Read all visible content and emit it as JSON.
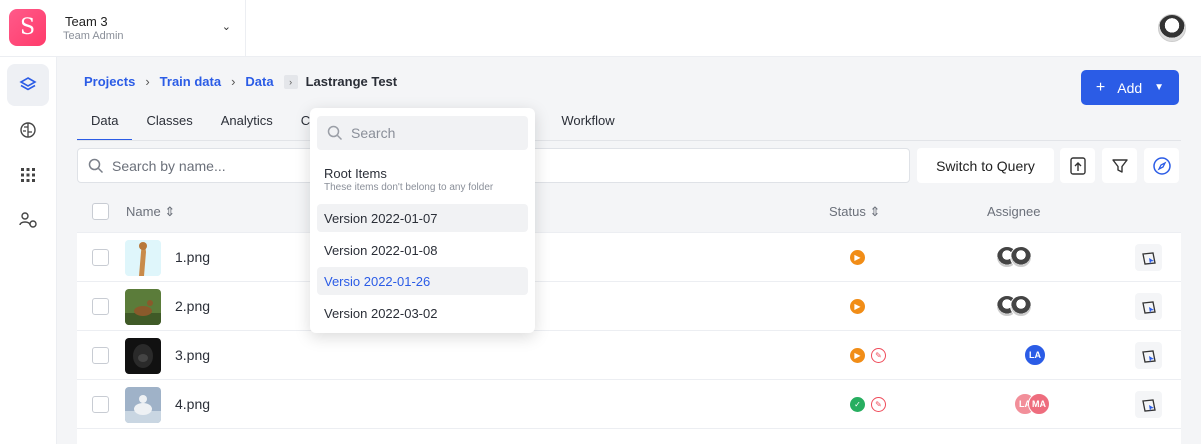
{
  "app": {
    "logo_letter": "S",
    "team_name": "Team 3",
    "team_role": "Team Admin"
  },
  "breadcrumb": {
    "items": [
      "Projects",
      "Train data",
      "Data"
    ],
    "current": "Lastrange Test"
  },
  "add_button": {
    "label": "Add"
  },
  "tabs": [
    {
      "label": "Data"
    },
    {
      "label": "Classes"
    },
    {
      "label": "Analytics"
    },
    {
      "label": "C"
    },
    {
      "label": "d"
    },
    {
      "label": "Workflow"
    }
  ],
  "search": {
    "placeholder": "Search by name..."
  },
  "switch_query": {
    "label": "Switch to Query"
  },
  "table": {
    "headers": {
      "name": "Name",
      "status": "Status",
      "assignee": "Assignee"
    },
    "rows": [
      {
        "name": "1.png",
        "status": [
          "in-progress"
        ],
        "assignee": [
          "avatar-img",
          "avatar-img"
        ]
      },
      {
        "name": "2.png",
        "status": [
          "in-progress"
        ],
        "assignee": [
          "avatar-img",
          "avatar-img"
        ]
      },
      {
        "name": "3.png",
        "status": [
          "in-progress",
          "rejected"
        ],
        "assignee": [
          "LA"
        ]
      },
      {
        "name": "4.png",
        "status": [
          "completed",
          "rejected"
        ],
        "assignee": [
          "LA",
          "MA"
        ]
      }
    ]
  },
  "dropdown": {
    "search_placeholder": "Search",
    "root_title": "Root Items",
    "root_subtitle": "These items don't belong to any folder",
    "items": [
      {
        "label": "Version 2022-01-07",
        "state": "highlighted"
      },
      {
        "label": "Version 2022-01-08",
        "state": "normal"
      },
      {
        "label": "Versio 2022-01-26",
        "state": "selected"
      },
      {
        "label": "Version 2022-03-02",
        "state": "normal"
      }
    ]
  },
  "colors": {
    "accent": "#2b5ce6",
    "brand": "#ff3b6b",
    "status_in_progress": "#f18d17",
    "status_completed": "#27ae60",
    "status_rejected": "#ef4b5a"
  }
}
